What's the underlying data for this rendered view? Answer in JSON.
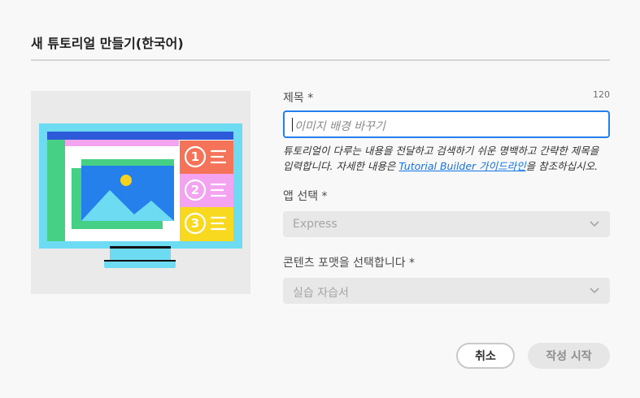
{
  "dialog": {
    "title": "새 튜토리얼 만들기(한국어)"
  },
  "form": {
    "title_field": {
      "label": "제목 *",
      "counter": "120",
      "placeholder": "이미지 배경 바꾸기"
    },
    "help": {
      "text_before": "튜토리얼이 다루는 내용을 전달하고 검색하기 쉬운 명백하고 간략한 제목을 입력합니다. 자세한 내용은 ",
      "link": "Tutorial Builder 가이드라인",
      "text_after": "을 참조하십시오."
    },
    "app_select": {
      "label": "앱 선택 *",
      "value": "Express"
    },
    "format_select": {
      "label": "콘텐츠 포맷을 선택합니다 *",
      "value": "실습 자습서"
    }
  },
  "buttons": {
    "cancel": "취소",
    "start": "작성 시작"
  },
  "colors": {
    "accent": "#2680eb",
    "link": "#1473e6"
  }
}
